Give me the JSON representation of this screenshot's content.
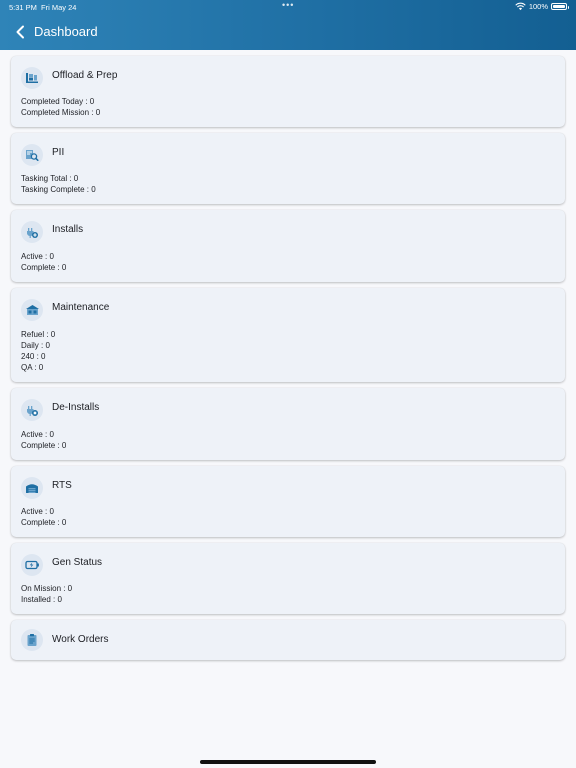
{
  "status_bar": {
    "time": "5:31 PM",
    "date": "Fri May 24",
    "dots": "•••",
    "battery_text": "100%"
  },
  "header": {
    "title": "Dashboard",
    "back_icon": "chevron-left-icon",
    "background_color": "#1f6fa4"
  },
  "cards": {
    "offload": {
      "title": "Offload & Prep",
      "icon": "offload-icon",
      "lines": [
        "Completed Today : 0",
        "Completed Mission : 0"
      ]
    },
    "pii": {
      "title": "PII",
      "icon": "pii-icon",
      "lines": [
        "Tasking Total : 0",
        "Tasking Complete : 0"
      ]
    },
    "installs": {
      "title": "Installs",
      "icon": "install-icon",
      "lines": [
        "Active : 0",
        "Complete : 0"
      ]
    },
    "maintenance": {
      "title": "Maintenance",
      "icon": "maintenance-icon",
      "lines": [
        "Refuel : 0",
        "Daily : 0",
        "240 : 0",
        "QA : 0"
      ]
    },
    "deinstalls": {
      "title": "De-Installs",
      "icon": "de-install-icon",
      "lines": [
        "Active : 0",
        "Complete : 0"
      ]
    },
    "rts": {
      "title": "RTS",
      "icon": "hangar-icon",
      "lines": [
        "Active : 0",
        "Complete : 0"
      ]
    },
    "gen_status": {
      "title": "Gen Status",
      "icon": "battery-charge-icon",
      "lines": [
        "On Mission : 0",
        "Installed : 0"
      ]
    },
    "work_orders": {
      "title": "Work Orders",
      "icon": "clipboard-icon",
      "lines": []
    }
  },
  "colors": {
    "card_background": "#eef2f8",
    "icon_blue": "#1f6fa4",
    "page_background": "#f7f8fb"
  }
}
